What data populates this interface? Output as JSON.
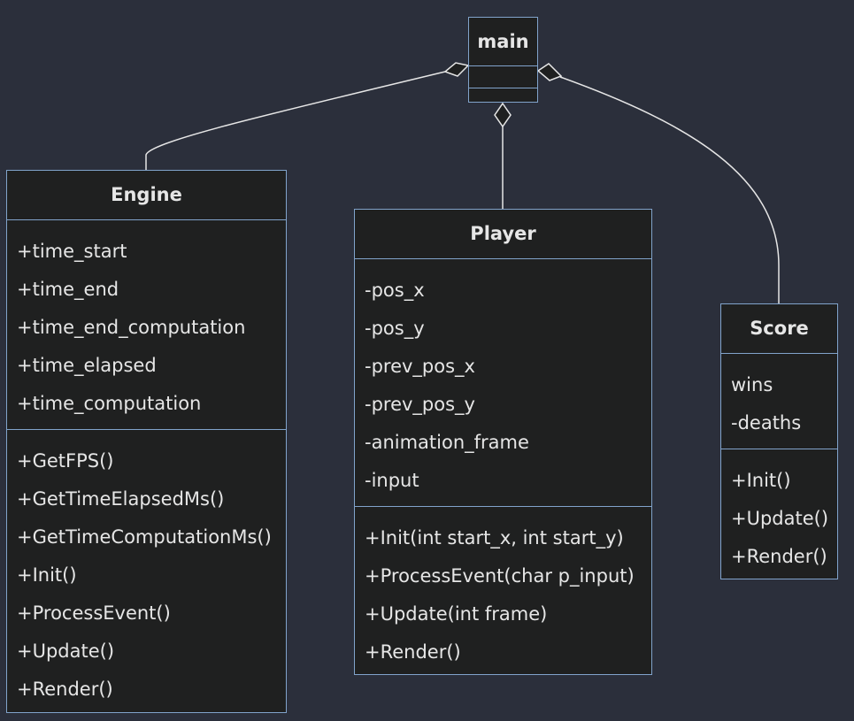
{
  "diagram": {
    "background": "#2b2f3b",
    "box_fill": "#1f2020",
    "box_border": "#81a3cb",
    "edge_color": "#e6e6e6",
    "relation": "aggregation",
    "classes": {
      "main": {
        "name": "main",
        "attributes": [],
        "methods": []
      },
      "engine": {
        "name": "Engine",
        "attributes": [
          "+time_start",
          "+time_end",
          "+time_end_computation",
          "+time_elapsed",
          "+time_computation"
        ],
        "methods": [
          "+GetFPS()",
          "+GetTimeElapsedMs()",
          "+GetTimeComputationMs()",
          "+Init()",
          "+ProcessEvent()",
          "+Update()",
          "+Render()"
        ]
      },
      "player": {
        "name": "Player",
        "attributes": [
          "-pos_x",
          "-pos_y",
          "-prev_pos_x",
          "-prev_pos_y",
          "-animation_frame",
          "-input"
        ],
        "methods": [
          "+Init(int start_x, int start_y)",
          "+ProcessEvent(char p_input)",
          "+Update(int frame)",
          "+Render()"
        ]
      },
      "score": {
        "name": "Score",
        "attributes": [
          "wins",
          "-deaths"
        ],
        "methods": [
          "+Init()",
          "+Update()",
          "+Render()"
        ]
      }
    },
    "edges": [
      {
        "from": "main",
        "to": "engine",
        "type": "aggregation"
      },
      {
        "from": "main",
        "to": "player",
        "type": "aggregation"
      },
      {
        "from": "main",
        "to": "score",
        "type": "aggregation"
      }
    ]
  }
}
